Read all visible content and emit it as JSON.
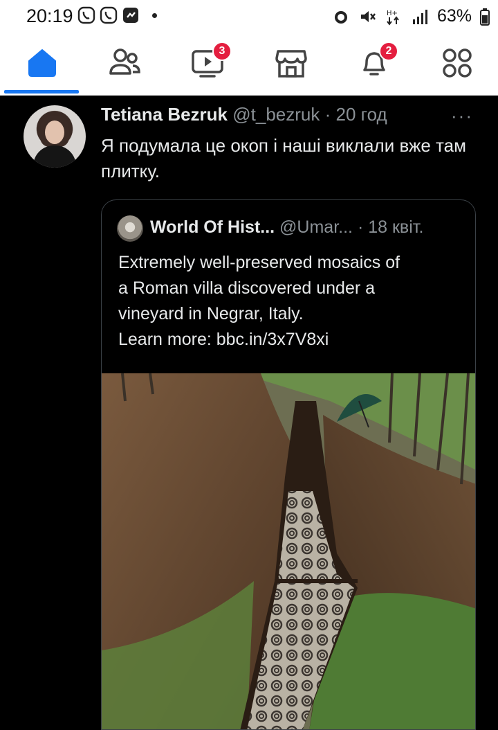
{
  "status_bar": {
    "time": "20:19",
    "battery": "63%",
    "left_icons": [
      "viber-icon",
      "viber-icon",
      "messenger-icon"
    ],
    "right_icons": [
      "alarm-icon",
      "mute-icon",
      "network-icon",
      "signal-icon",
      "battery-icon"
    ]
  },
  "fb_nav": {
    "items": [
      {
        "name": "home",
        "icon": "home-icon",
        "active": true
      },
      {
        "name": "friends",
        "icon": "friends-icon"
      },
      {
        "name": "watch",
        "icon": "video-icon",
        "badge": "3"
      },
      {
        "name": "marketplace",
        "icon": "marketplace-icon"
      },
      {
        "name": "notifications",
        "icon": "bell-icon",
        "badge": "2"
      },
      {
        "name": "menu",
        "icon": "menu-grid-icon"
      }
    ],
    "accent": "#1877f2",
    "badge_color": "#e41e3f"
  },
  "tweet": {
    "author": "Tetiana Bezruk",
    "handle": "@t_bezruk",
    "separator": "·",
    "time_ago": "20 год",
    "more": "···",
    "text": "Я подумала це окоп і наші виклали вже там плитку."
  },
  "quote": {
    "author": "World Of Hist...",
    "handle": "@Umar...",
    "separator": "·",
    "date": "18 квіт.",
    "text_lines": [
      "Extremely well-preserved mosaics of",
      "a Roman villa discovered under a",
      "vineyard in Negrar, Italy.",
      "Learn more: bbc.in/3x7V8xi"
    ],
    "image": "trench-mosaic-photo"
  }
}
